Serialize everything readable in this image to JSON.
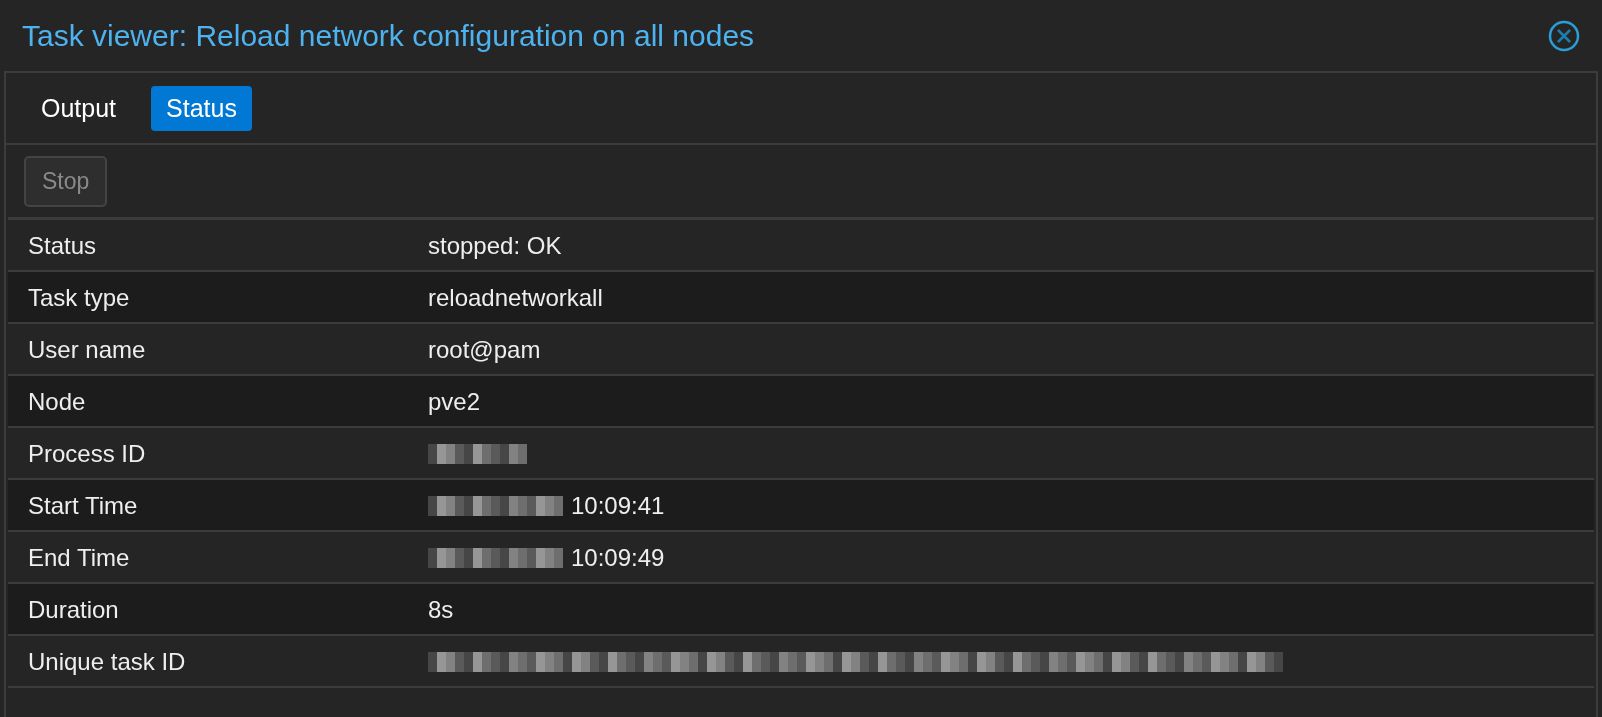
{
  "window": {
    "title": "Task viewer: Reload network configuration on all nodes"
  },
  "tabs": [
    {
      "label": "Output",
      "selected": false
    },
    {
      "label": "Status",
      "selected": true
    }
  ],
  "toolbar": {
    "stop_button": {
      "label": "Stop",
      "disabled": true
    }
  },
  "rows": [
    {
      "kind": "text",
      "label": "Status",
      "value": "stopped: OK"
    },
    {
      "kind": "text",
      "label": "Task type",
      "value": "reloadnetworkall"
    },
    {
      "kind": "text",
      "label": "User name",
      "value": "root@pam"
    },
    {
      "kind": "text",
      "label": "Node",
      "value": "pve2"
    },
    {
      "kind": "pid",
      "label": "Process ID"
    },
    {
      "kind": "time",
      "label": "Start Time",
      "value": "10:09:41"
    },
    {
      "kind": "time",
      "label": "End Time",
      "value": "10:09:49"
    },
    {
      "kind": "text",
      "label": "Duration",
      "value": "8s"
    },
    {
      "kind": "upid",
      "label": "Unique task ID"
    }
  ]
}
